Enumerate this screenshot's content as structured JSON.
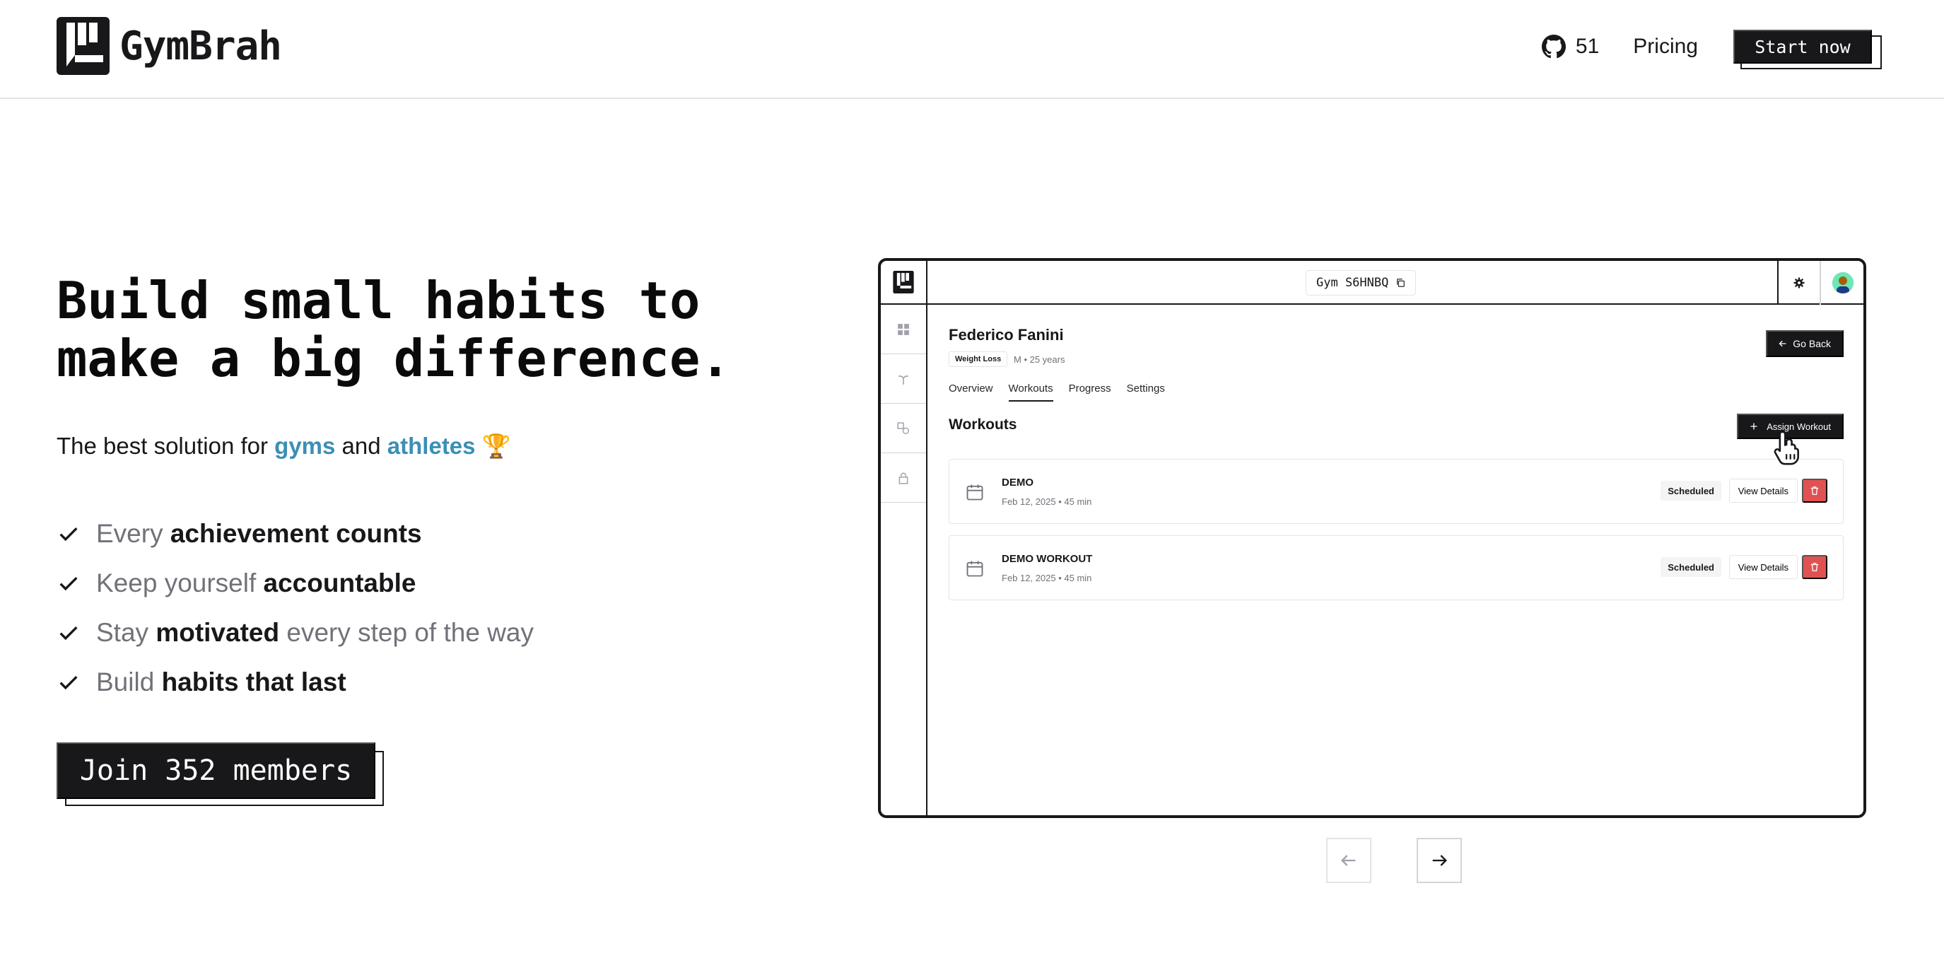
{
  "header": {
    "brand": "GymBrah",
    "github_count": "51",
    "pricing_label": "Pricing",
    "cta_label": "Start now"
  },
  "hero": {
    "headline_line1": "Build small habits to",
    "headline_line2": "make a big difference.",
    "sub_prefix": "The best solution for ",
    "sub_gyms": "gyms",
    "sub_and": " and ",
    "sub_athletes": "athletes",
    "sub_emoji": "🏆",
    "features": [
      {
        "pre": "Every ",
        "bold": "achievement counts",
        "post": ""
      },
      {
        "pre": "Keep yourself ",
        "bold": "accountable",
        "post": ""
      },
      {
        "pre": "Stay ",
        "bold": "motivated",
        "post": " every step of the way"
      },
      {
        "pre": "Build ",
        "bold": "habits that last",
        "post": ""
      }
    ],
    "join_label": "Join 352 members"
  },
  "mockup": {
    "gym_code": "Gym S6HNBQ",
    "athlete_name": "Federico Fanini",
    "goal_badge": "Weight Loss",
    "athlete_meta": "M • 25 years",
    "go_back_label": "Go Back",
    "tabs": [
      {
        "label": "Overview"
      },
      {
        "label": "Workouts"
      },
      {
        "label": "Progress"
      },
      {
        "label": "Settings"
      }
    ],
    "active_tab": "Workouts",
    "section_title": "Workouts",
    "assign_label": "Assign Workout",
    "workouts": [
      {
        "title": "DEMO",
        "subtitle": "Feb 12, 2025 • 45 min",
        "status": "Scheduled",
        "details_label": "View Details"
      },
      {
        "title": "DEMO WORKOUT",
        "subtitle": "Feb 12, 2025 • 45 min",
        "status": "Scheduled",
        "details_label": "View Details"
      }
    ]
  },
  "colors": {
    "primary": "#18181b",
    "accent": "#3b8fb4",
    "danger": "#e05252",
    "muted_text": "#71717a"
  }
}
